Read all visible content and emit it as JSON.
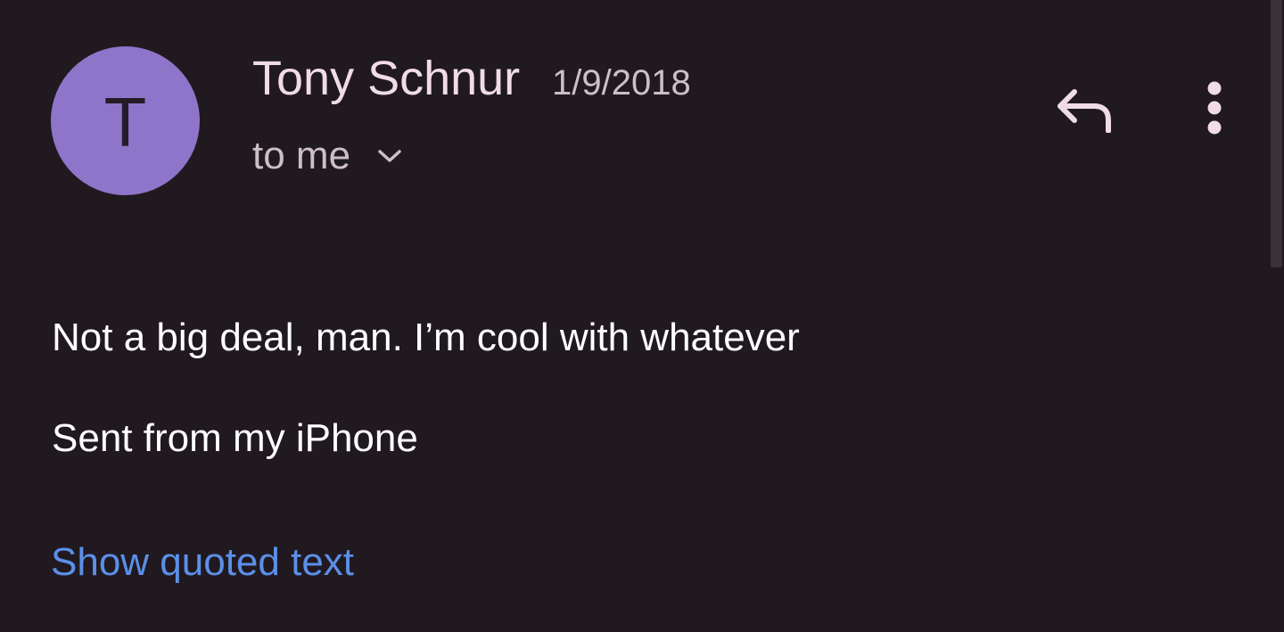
{
  "message": {
    "avatar_initial": "T",
    "avatar_color": "#8f75c9",
    "sender_name": "Tony Schnur",
    "date": "1/9/2018",
    "recipient_label": "to me",
    "body_lines": [
      "Not a big deal, man. I’m cool with whatever",
      "Sent from my iPhone"
    ],
    "show_quoted_label": "Show quoted text"
  },
  "icons": {
    "recipient_toggle": "chevron-down-icon",
    "reply": "reply-icon",
    "more": "more-vertical-icon"
  },
  "colors": {
    "background": "#201920",
    "sender_text": "#f0dbe6",
    "secondary_text": "#cdbec7",
    "link": "#5c8fe8"
  }
}
